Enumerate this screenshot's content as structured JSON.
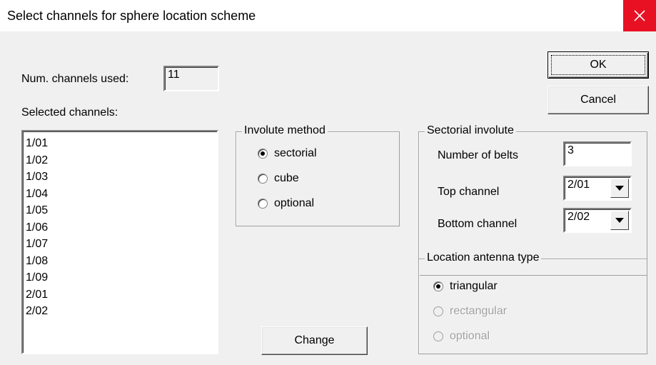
{
  "window": {
    "title": "Select channels for sphere location scheme",
    "close_icon": "close-icon",
    "close_color": "#e81123"
  },
  "num_channels": {
    "label": "Num. channels used:",
    "value": "11"
  },
  "selected_channels": {
    "label": "Selected channels:",
    "items": [
      "1/01",
      "1/02",
      "1/03",
      "1/04",
      "1/05",
      "1/06",
      "1/07",
      "1/08",
      "1/09",
      "2/01",
      "2/02"
    ]
  },
  "involute_method": {
    "title": "Involute method",
    "options": [
      {
        "label": "sectorial",
        "checked": true
      },
      {
        "label": "cube",
        "checked": false
      },
      {
        "label": "optional",
        "checked": false
      }
    ]
  },
  "sectorial_involute": {
    "title": "Sectorial involute",
    "number_of_belts": {
      "label": "Number of belts",
      "value": "3"
    },
    "top_channel": {
      "label": "Top channel",
      "value": "2/01"
    },
    "bottom_channel": {
      "label": "Bottom channel",
      "value": "2/02"
    }
  },
  "antenna_type": {
    "title": "Location antenna type",
    "options": [
      {
        "label": "triangular",
        "checked": true,
        "enabled": true
      },
      {
        "label": "rectangular",
        "checked": false,
        "enabled": false
      },
      {
        "label": "optional",
        "checked": false,
        "enabled": false
      }
    ]
  },
  "buttons": {
    "ok": "OK",
    "cancel": "Cancel",
    "change": "Change"
  }
}
